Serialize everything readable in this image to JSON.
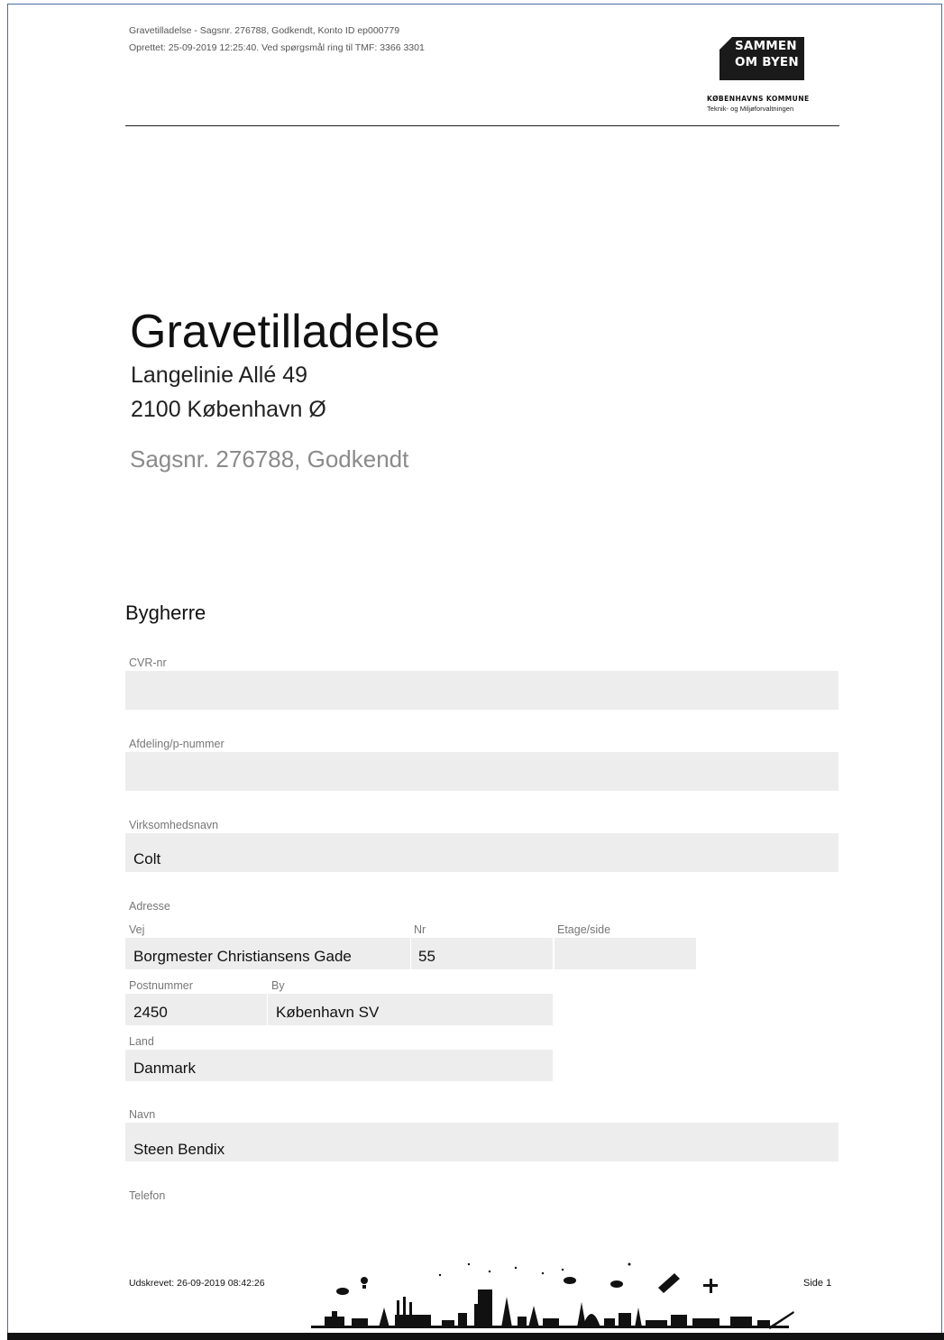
{
  "header": {
    "line1": "Gravetilladelse - Sagsnr. 276788, Godkendt, Konto ID ep000779",
    "line2": "Oprettet: 25-09-2019 12:25:40. Ved spørgsmål ring til TMF: 3366 3301"
  },
  "logo": {
    "line1": "SAMMEN",
    "line2": "OM BYEN",
    "org": "KØBENHAVNS KOMMUNE",
    "dept": "Teknik- og Miljøforvaltningen"
  },
  "document": {
    "title": "Gravetilladelse",
    "street": "Langelinie Allé 49",
    "city": "2100 København Ø",
    "case": "Sagsnr. 276788, Godkendt"
  },
  "bygherre": {
    "heading": "Bygherre",
    "cvr": {
      "label": "CVR-nr",
      "value": ""
    },
    "afdeling": {
      "label": "Afdeling/p-nummer",
      "value": ""
    },
    "virksomhed": {
      "label": "Virksomhedsnavn",
      "value": "Colt"
    },
    "adresse": {
      "label": "Adresse",
      "vej": {
        "label": "Vej",
        "value": "Borgmester Christiansens Gade"
      },
      "nr": {
        "label": "Nr",
        "value": "55"
      },
      "etage": {
        "label": "Etage/side",
        "value": ""
      },
      "postnummer": {
        "label": "Postnummer",
        "value": "2450"
      },
      "by": {
        "label": "By",
        "value": "København SV"
      },
      "land": {
        "label": "Land",
        "value": "Danmark"
      }
    },
    "navn": {
      "label": "Navn",
      "value": "Steen Bendix"
    },
    "telefon": {
      "label": "Telefon"
    }
  },
  "footer": {
    "printed": "Udskrevet: 26-09-2019 08:42:26",
    "page": "Side 1"
  },
  "colors": {
    "field_bg": "#ededed",
    "label": "#777777",
    "case_text": "#8a8a8a",
    "logo_bg": "#1a1a1a"
  }
}
